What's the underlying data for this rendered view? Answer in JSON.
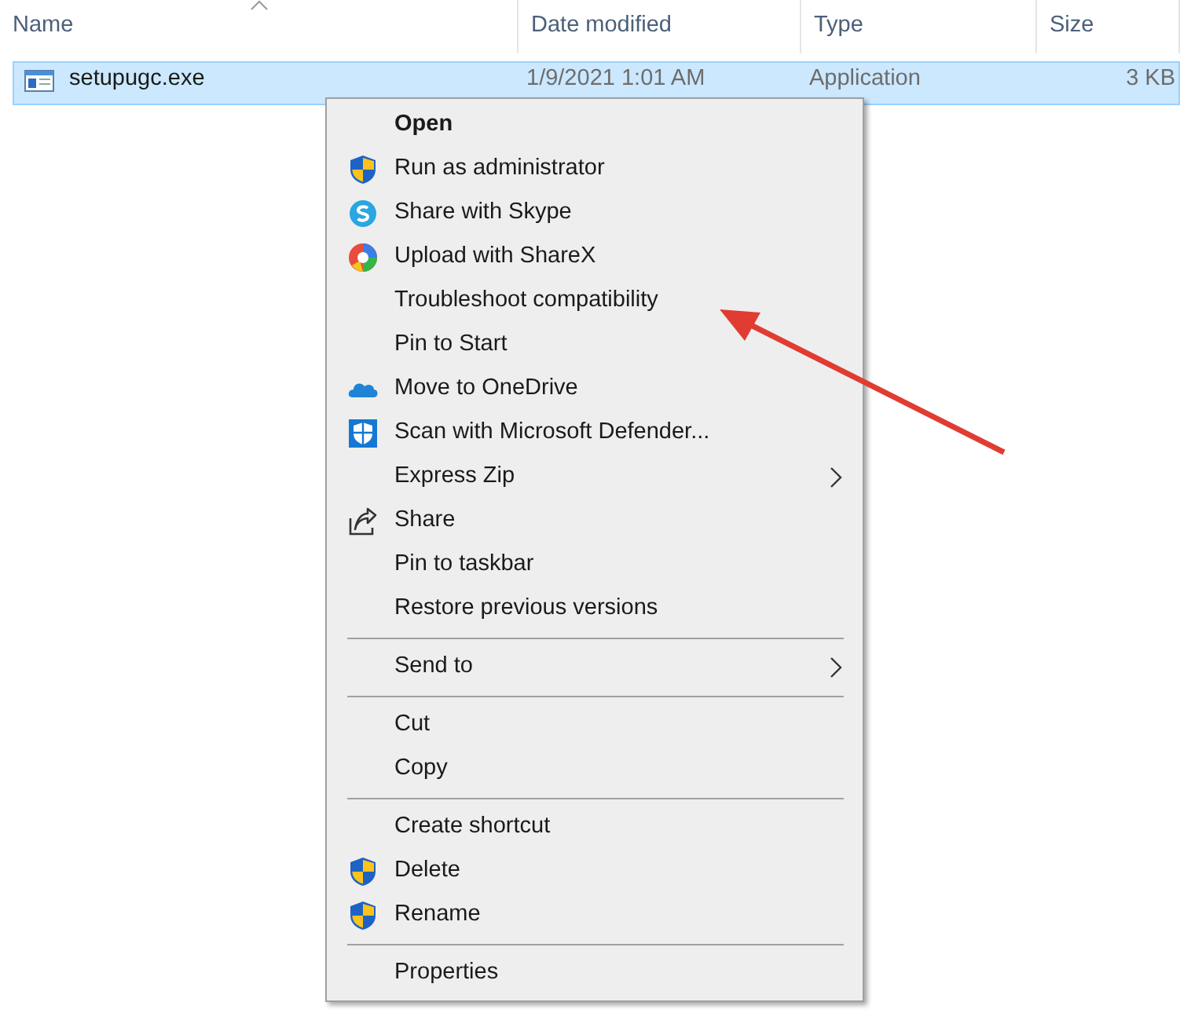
{
  "columns": [
    {
      "label": "Name",
      "sorted": true
    },
    {
      "label": "Date modified",
      "sorted": false
    },
    {
      "label": "Type",
      "sorted": false
    },
    {
      "label": "Size",
      "sorted": false
    }
  ],
  "files": [
    {
      "name": "setupugc.exe",
      "date": "1/9/2021 1:01 AM",
      "type": "Application",
      "size": "3 KB",
      "selected": true
    }
  ],
  "context_menu": [
    {
      "kind": "item",
      "label": "Open",
      "default": true
    },
    {
      "kind": "shield",
      "label": "Run as administrator"
    },
    {
      "kind": "skype",
      "label": "Share with Skype"
    },
    {
      "kind": "sharex",
      "label": "Upload with ShareX"
    },
    {
      "kind": "item",
      "label": "Troubleshoot compatibility"
    },
    {
      "kind": "item",
      "label": "Pin to Start"
    },
    {
      "kind": "cloud",
      "label": "Move to OneDrive"
    },
    {
      "kind": "defender",
      "label": "Scan with Microsoft Defender..."
    },
    {
      "kind": "item",
      "label": "Express Zip",
      "submenu": true
    },
    {
      "kind": "share",
      "label": "Share"
    },
    {
      "kind": "item",
      "label": "Pin to taskbar"
    },
    {
      "kind": "item",
      "label": "Restore previous versions"
    },
    {
      "kind": "separator"
    },
    {
      "kind": "item",
      "label": "Send to",
      "submenu": true
    },
    {
      "kind": "separator"
    },
    {
      "kind": "item",
      "label": "Cut"
    },
    {
      "kind": "item",
      "label": "Copy"
    },
    {
      "kind": "separator"
    },
    {
      "kind": "item",
      "label": "Create shortcut"
    },
    {
      "kind": "shield",
      "label": "Delete"
    },
    {
      "kind": "shield",
      "label": "Rename"
    },
    {
      "kind": "separator"
    },
    {
      "kind": "item",
      "label": "Properties"
    }
  ],
  "annotation": {
    "kind": "arrow",
    "color": "#e03c31"
  }
}
